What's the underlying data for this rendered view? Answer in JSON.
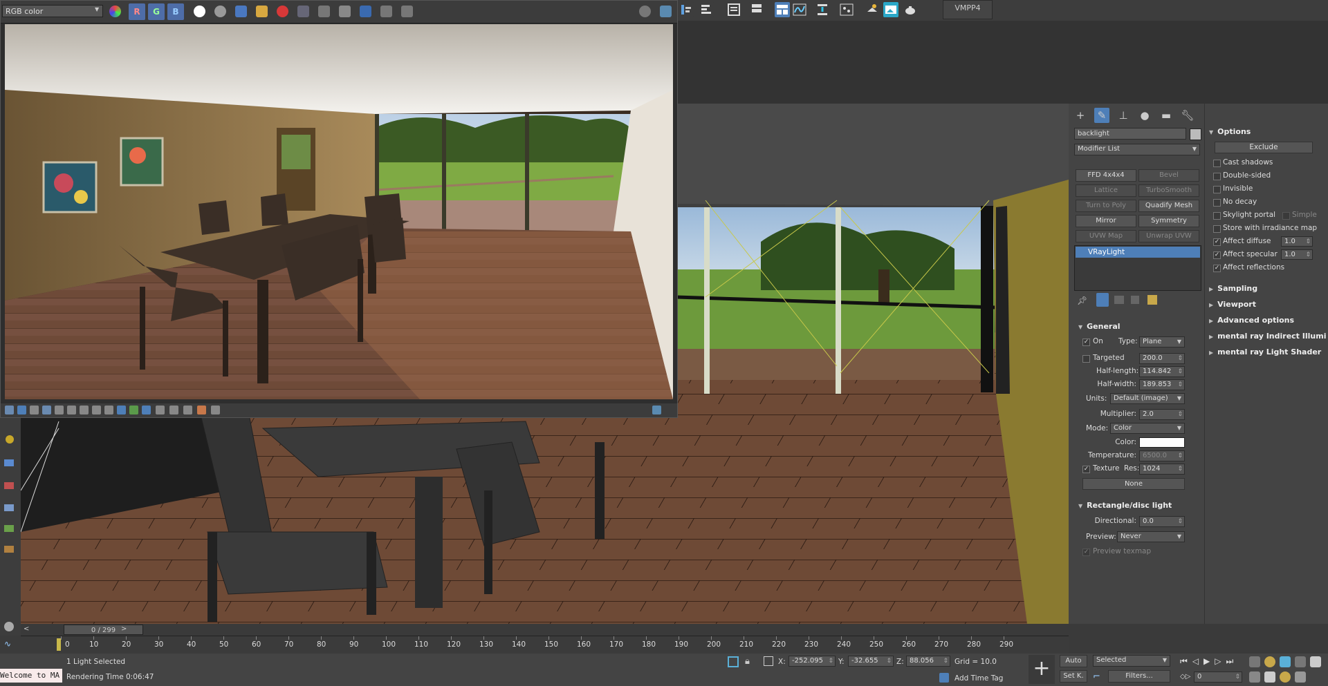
{
  "top_toolbar": {
    "vmpp_label": "VMPP4",
    "icons": [
      "align-icon",
      "layers-icon",
      "ribbon-icon",
      "scene-explorer-icon",
      "layer-manager-icon",
      "curve-editor-icon",
      "schematic-icon",
      "material-editor-icon",
      "render-setup-icon",
      "rendered-frame-icon",
      "render-icon",
      "teapot-icon"
    ]
  },
  "render_window": {
    "channel": "RGB color",
    "channels": [
      "R",
      "G",
      "B"
    ],
    "icons": [
      "color-sphere-icon",
      "white-circle-icon",
      "grey-circle-icon",
      "save-icon",
      "open-icon",
      "clear-icon",
      "region-icon",
      "track-mouse-icon",
      "teapot-icon",
      "link-icon",
      "lut-icon",
      "histogram-icon",
      "settings-icon",
      "pin-icon"
    ]
  },
  "command_panel": {
    "tabs": [
      "create-tab",
      "modify-tab",
      "hierarchy-tab",
      "motion-tab",
      "display-tab",
      "utilities-tab"
    ],
    "object_name": "backlight",
    "modifier_list": "Modifier List",
    "modifier_buttons": [
      {
        "label": "FFD 4x4x4",
        "enabled": true
      },
      {
        "label": "Bevel",
        "enabled": false
      },
      {
        "label": "Lattice",
        "enabled": false
      },
      {
        "label": "TurboSmooth",
        "enabled": false
      },
      {
        "label": "Turn to Poly",
        "enabled": false
      },
      {
        "label": "Quadify Mesh",
        "enabled": true
      },
      {
        "label": "Mirror",
        "enabled": true
      },
      {
        "label": "Symmetry",
        "enabled": true
      },
      {
        "label": "UVW Map",
        "enabled": false
      },
      {
        "label": "Unwrap UVW",
        "enabled": false
      }
    ],
    "stack_item": "VRayLight",
    "general": {
      "title": "General",
      "on_label": "On",
      "type_label": "Type:",
      "type_value": "Plane",
      "targeted_label": "Targeted",
      "targeted_value": "200.0",
      "half_length_label": "Half-length:",
      "half_length_value": "114.842",
      "half_width_label": "Half-width:",
      "half_width_value": "189.853",
      "units_label": "Units:",
      "units_value": "Default (image)",
      "multiplier_label": "Multiplier:",
      "multiplier_value": "2.0",
      "mode_label": "Mode:",
      "mode_value": "Color",
      "color_label": "Color:",
      "color_value": "#ffffff",
      "temperature_label": "Temperature:",
      "temperature_value": "6500.0",
      "texture_label": "Texture",
      "res_label": "Res:",
      "res_value": "1024",
      "map_button": "None"
    },
    "rect_disc": {
      "title": "Rectangle/disc light",
      "directional_label": "Directional:",
      "directional_value": "0.0",
      "preview_label": "Preview:",
      "preview_value": "Never",
      "preview_texmap_label": "Preview texmap"
    }
  },
  "rollout_panel": {
    "options_title": "Options",
    "exclude_button": "Exclude",
    "cast_shadows": "Cast shadows",
    "double_sided": "Double-sided",
    "invisible": "Invisible",
    "no_decay": "No decay",
    "skylight_portal": "Skylight portal",
    "simple": "Simple",
    "store_irradiance": "Store with irradiance map",
    "affect_diffuse": "Affect diffuse",
    "affect_diffuse_value": "1.0",
    "affect_specular": "Affect specular",
    "affect_specular_value": "1.0",
    "affect_reflections": "Affect reflections",
    "sections": [
      "Sampling",
      "Viewport",
      "Advanced options",
      "mental ray Indirect Illumi",
      "mental ray Light Shader"
    ]
  },
  "timeline": {
    "frame_display": "0 / 299",
    "ticks": [
      "0",
      "10",
      "20",
      "30",
      "40",
      "50",
      "60",
      "70",
      "80",
      "90",
      "100",
      "110",
      "120",
      "130",
      "140",
      "150",
      "160",
      "170",
      "180",
      "190",
      "200",
      "210",
      "220",
      "230",
      "240",
      "250",
      "260",
      "270",
      "280",
      "290"
    ]
  },
  "status": {
    "maxscript": "Welcome to MA",
    "selection": "1 Light Selected",
    "render_time": "Rendering Time  0:06:47",
    "x_label": "X:",
    "x_value": "-252.095",
    "y_label": "Y:",
    "y_value": "-32.655",
    "z_label": "Z:",
    "z_value": "88.056",
    "grid": "Grid = 10.0",
    "add_time_tag": "Add Time Tag",
    "auto_key": "Auto",
    "set_key": "Set K.",
    "selected_dropdown": "Selected",
    "filters": "Filters...",
    "current_frame": "0"
  }
}
